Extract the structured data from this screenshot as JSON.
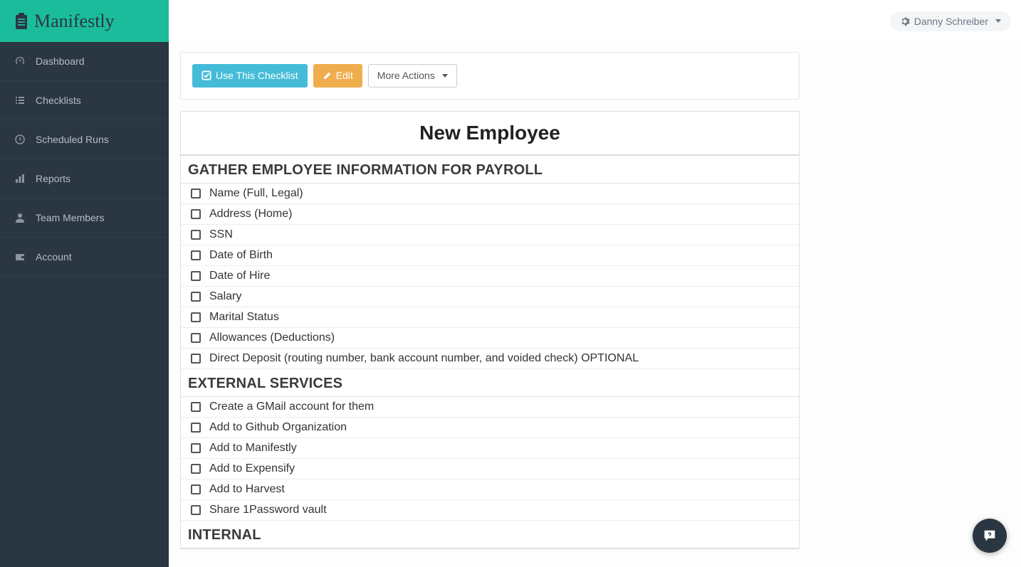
{
  "brand": {
    "name": "Manifestly"
  },
  "user": {
    "name": "Danny Schreiber"
  },
  "nav": {
    "items": [
      {
        "key": "dashboard",
        "label": "Dashboard",
        "icon": "gauge-icon"
      },
      {
        "key": "checklists",
        "label": "Checklists",
        "icon": "list-icon"
      },
      {
        "key": "scheduled",
        "label": "Scheduled Runs",
        "icon": "clock-icon"
      },
      {
        "key": "reports",
        "label": "Reports",
        "icon": "bar-chart-icon"
      },
      {
        "key": "team",
        "label": "Team Members",
        "icon": "user-icon"
      },
      {
        "key": "account",
        "label": "Account",
        "icon": "wallet-icon"
      }
    ]
  },
  "actions": {
    "use_label": "Use This Checklist",
    "edit_label": "Edit",
    "more_label": "More Actions"
  },
  "checklist": {
    "title": "New Employee",
    "sections": [
      {
        "header": "GATHER EMPLOYEE INFORMATION FOR PAYROLL",
        "tasks": [
          "Name (Full, Legal)",
          "Address (Home)",
          "SSN",
          "Date of Birth",
          "Date of Hire",
          "Salary",
          "Marital Status",
          "Allowances (Deductions)",
          "Direct Deposit (routing number, bank account number, and voided check) OPTIONAL"
        ]
      },
      {
        "header": "EXTERNAL SERVICES",
        "tasks": [
          "Create a GMail account for them",
          "Add to Github Organization",
          "Add to Manifestly",
          "Add to Expensify",
          "Add to Harvest",
          "Share 1Password vault"
        ]
      },
      {
        "header": "INTERNAL",
        "tasks": []
      }
    ]
  }
}
